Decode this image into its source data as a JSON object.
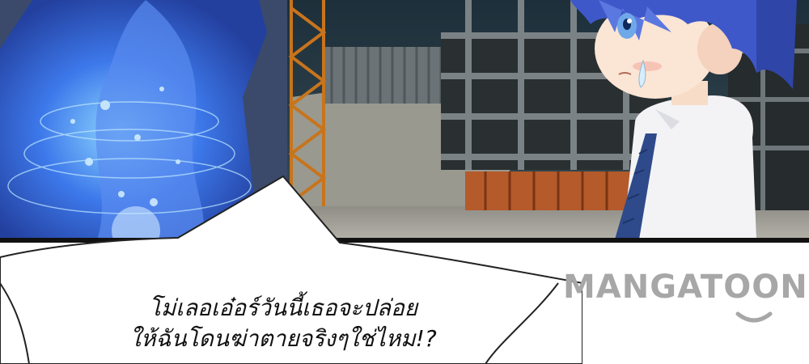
{
  "speech_bubble": {
    "line1": "โม่เลอเอ๋อร์วันนี้เธอจะปล่อย",
    "line2": "ให้ฉันโดนฆ่าตายจริงๆใช่ไหม!?"
  },
  "watermark": {
    "text": "MANGATOON"
  },
  "colors": {
    "panel_border": "#111111",
    "bubble_fill": "#ffffff",
    "character_hair": "#3f58c9",
    "magic_robe": "#4a6fe0",
    "watermark_gray": "#a7a7a7"
  }
}
